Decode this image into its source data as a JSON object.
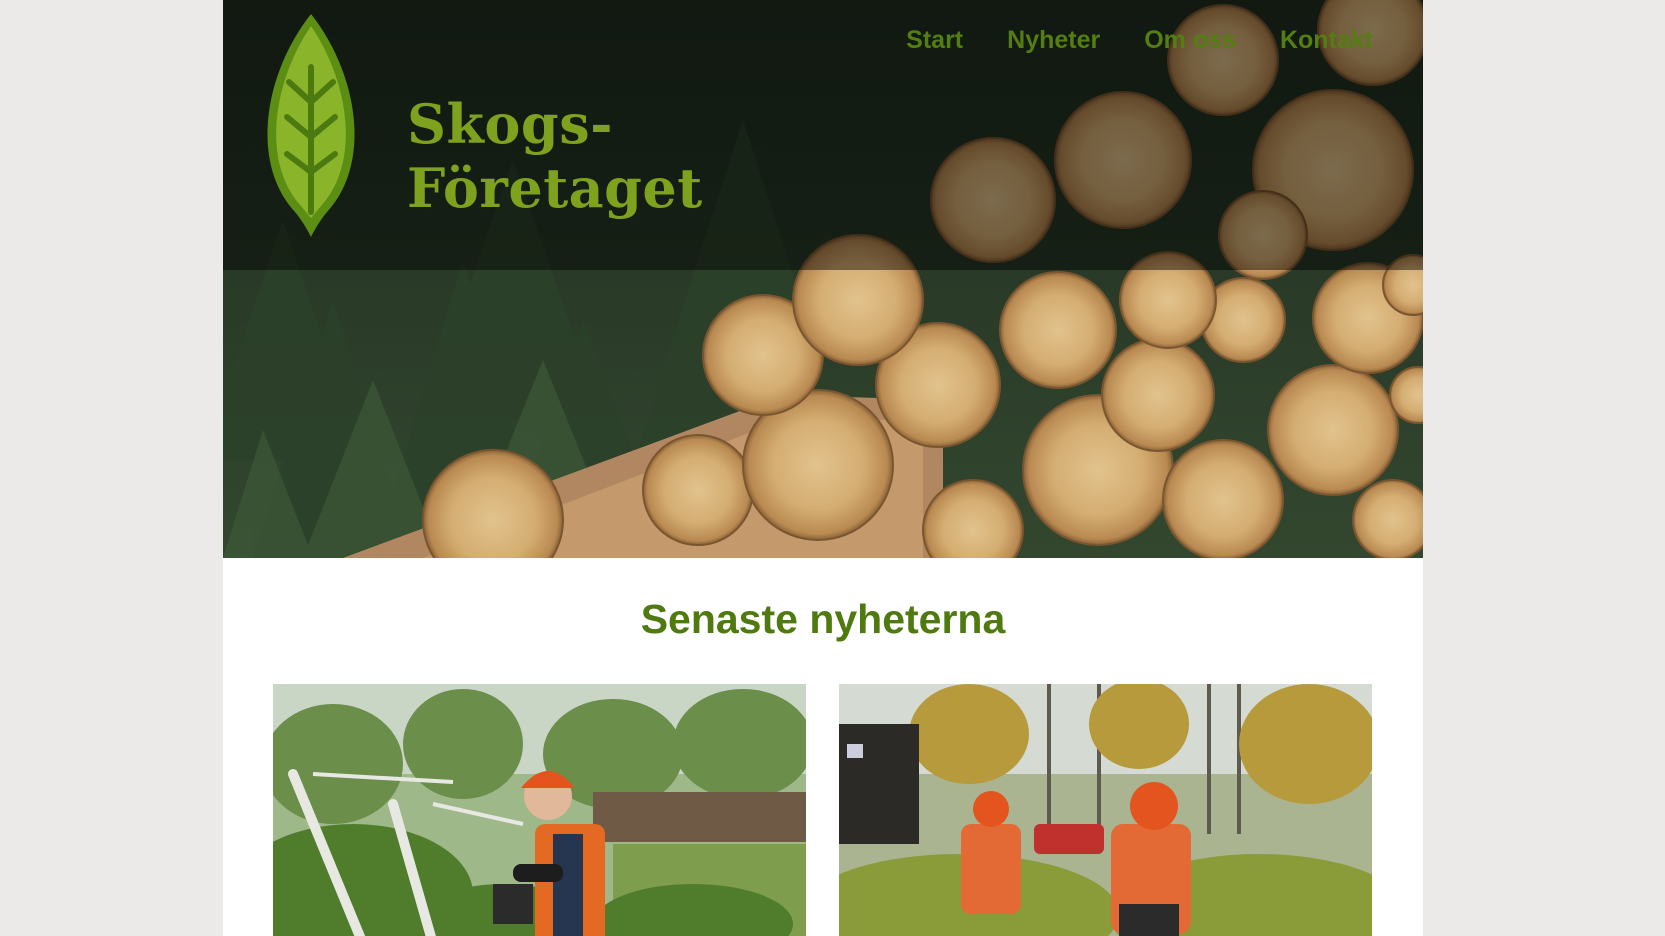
{
  "site": {
    "logo_line1": "Skogs-",
    "logo_line2": "Företaget"
  },
  "nav": {
    "items": [
      {
        "label": "Start"
      },
      {
        "label": "Nyheter"
      },
      {
        "label": "Om oss"
      },
      {
        "label": "Kontakt"
      }
    ]
  },
  "news": {
    "heading": "Senaste nyheterna"
  },
  "colors": {
    "brand_green": "#547e11",
    "logo_green": "#7ea11e",
    "page_bg": "#ebeae8"
  }
}
